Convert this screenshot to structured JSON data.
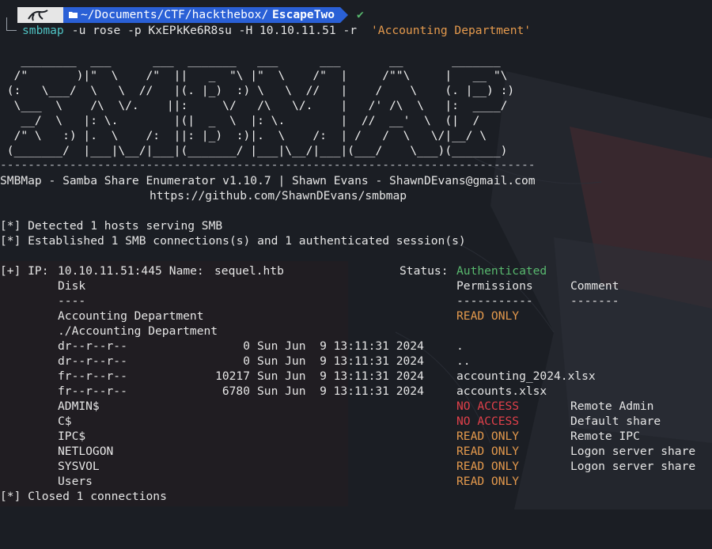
{
  "prompt": {
    "path_prefix": "~/Documents/CTF/hackthebox/",
    "path_current": "EscapeTwo",
    "status_mark": "✔",
    "command": "smbmap",
    "args": " -u rose -p KxEPkKe6R8su -H 10.10.11.51 -r ",
    "quoted_arg": "'Accounting Department'"
  },
  "banner": {
    "ascii": [
      "   ________  ___      ___  _______   ___      ___       __       _______",
      "  /\"       )|\"  \\    /\"  ||   _  \"\\ |\"  \\    /\"  |     /\"\"\\     |   __ \"\\",
      " (:   \\___/  \\   \\  //   |(. |_)  :) \\   \\  //   |    /    \\    (. |__) :)",
      "  \\___  \\    /\\  \\/.    ||:     \\/   /\\   \\/.    |   /' /\\  \\   |:  ____/",
      "   __/  \\   |: \\.        |(|  _  \\  |: \\.        |  //  __'  \\  (|  /",
      "  /\" \\   :) |.  \\    /:  ||: |_)  :)|.  \\    /:  | /   /  \\   \\/|__/ \\",
      " (_______/  |___|\\__/|___|(_______/ |___|\\__/|___|(___/    \\___)(_______)"
    ],
    "rule": "-----------------------------------------------------------------------------",
    "credit": "SMBMap - Samba Share Enumerator v1.10.7 | Shawn Evans - ShawnDEvans@gmail.com",
    "url": "https://github.com/ShawnDEvans/smbmap"
  },
  "messages": {
    "detected": "[*] Detected 1 hosts serving SMB",
    "established": "[*] Established 1 SMB connections(s) and 1 authenticated session(s)",
    "closed": "[*] Closed 1 connections"
  },
  "host": {
    "prefix": "[+] IP: ",
    "ip": "10.10.11.51:445",
    "name_label": " Name: ",
    "name": "sequel.htb",
    "status_label": "Status: ",
    "status": "Authenticated"
  },
  "table": {
    "col_disk": "Disk",
    "col_permissions": "Permissions",
    "col_comment": "Comment",
    "rule_disk": "----",
    "rule_permissions": "-----------",
    "rule_comment": "-------"
  },
  "listing": {
    "share": "Accounting Department",
    "share_permission": "READ ONLY",
    "path": "./Accounting Department",
    "entries": [
      {
        "mode": "dr--r--r--",
        "size": "0",
        "date": "Sun Jun  9 13:11:31 2024",
        "name": "."
      },
      {
        "mode": "dr--r--r--",
        "size": "0",
        "date": "Sun Jun  9 13:11:31 2024",
        "name": ".."
      },
      {
        "mode": "fr--r--r--",
        "size": "10217",
        "date": "Sun Jun  9 13:11:31 2024",
        "name": "accounting_2024.xlsx"
      },
      {
        "mode": "fr--r--r--",
        "size": "6780",
        "date": "Sun Jun  9 13:11:31 2024",
        "name": "accounts.xlsx"
      }
    ]
  },
  "shares": [
    {
      "name": "ADMIN$",
      "permission": "NO ACCESS",
      "comment": "Remote Admin",
      "level": "none"
    },
    {
      "name": "C$",
      "permission": "NO ACCESS",
      "comment": "Default share",
      "level": "none"
    },
    {
      "name": "IPC$",
      "permission": "READ ONLY",
      "comment": "Remote IPC",
      "level": "read"
    },
    {
      "name": "NETLOGON",
      "permission": "READ ONLY",
      "comment": "Logon server share",
      "level": "read"
    },
    {
      "name": "SYSVOL",
      "permission": "READ ONLY",
      "comment": "Logon server share",
      "level": "read"
    },
    {
      "name": "Users",
      "permission": "READ ONLY",
      "comment": "",
      "level": "read"
    }
  ],
  "colors": {
    "background": "#1b1e24",
    "path_segment": "#2a60d6",
    "command": "#4fc3c3",
    "string": "#e59a4d",
    "no_access": "#e0404a",
    "authenticated": "#58b86e"
  },
  "icons": {
    "dragon": "kali-dragon-icon",
    "folder": "folder-open-icon"
  }
}
